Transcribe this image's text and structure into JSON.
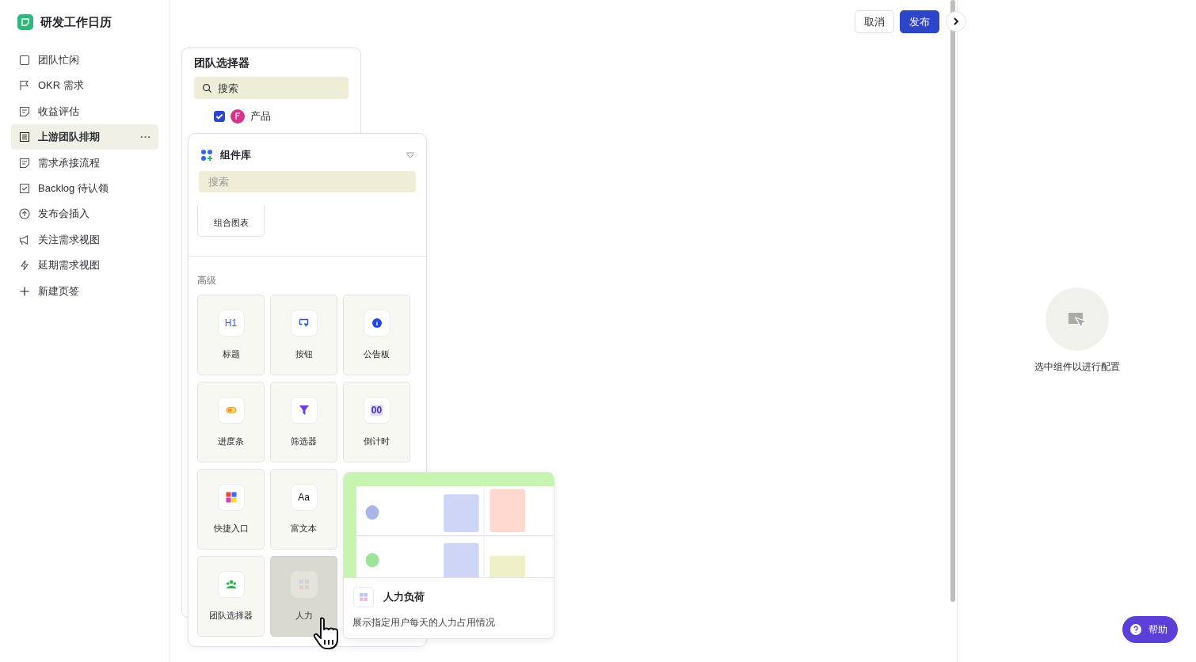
{
  "app": {
    "title": "研发工作日历"
  },
  "sidebar": {
    "items": [
      {
        "label": "团队忙闲",
        "selected": false
      },
      {
        "label": "OKR 需求",
        "selected": false
      },
      {
        "label": "收益评估",
        "selected": false
      },
      {
        "label": "上游团队排期",
        "selected": true
      },
      {
        "label": "需求承接流程",
        "selected": false
      },
      {
        "label": "Backlog 待认领",
        "selected": false
      },
      {
        "label": "发布会插入",
        "selected": false
      },
      {
        "label": "关注需求视图",
        "selected": false
      },
      {
        "label": "延期需求视图",
        "selected": false
      },
      {
        "label": "新建页签",
        "selected": false
      }
    ]
  },
  "toolbar": {
    "buttons": [
      {
        "label": "取消",
        "kind": "secondary"
      },
      {
        "label": "发布",
        "kind": "primary"
      }
    ]
  },
  "team_selector": {
    "title": "团队选择器",
    "search": {
      "placeholder": "搜索"
    },
    "teams": [
      {
        "label": "产品",
        "checked": true
      }
    ]
  },
  "component_library": {
    "title": "组件库",
    "search": {
      "placeholder": "搜索"
    },
    "basic_tiles": [
      {
        "label": "组合图表"
      }
    ],
    "sections": [
      {
        "title": "高级",
        "tiles": [
          {
            "label": "标题",
            "kind": "heading",
            "glyph": "H1",
            "selected": false
          },
          {
            "label": "按钮",
            "kind": "button",
            "selected": false
          },
          {
            "label": "公告板",
            "kind": "info",
            "selected": false
          },
          {
            "label": "进度条",
            "kind": "progress",
            "selected": false
          },
          {
            "label": "筛选器",
            "kind": "filter",
            "selected": false
          },
          {
            "label": "倒计时",
            "kind": "countdown",
            "glyph": "00",
            "selected": false
          },
          {
            "label": "快捷入口",
            "kind": "shortcut",
            "selected": false
          },
          {
            "label": "富文本",
            "kind": "richtext",
            "glyph": "Aa",
            "selected": false
          },
          {
            "label": "团队选择器",
            "kind": "team",
            "selected": false
          },
          {
            "label": "人力",
            "kind": "workload",
            "selected": true
          }
        ]
      }
    ]
  },
  "preview": {
    "title": "人力负荷",
    "description": "展示指定用户每天的人力占用情况"
  },
  "config_panel": {
    "empty_text": "选中组件以进行配置"
  },
  "help_button": {
    "label": "帮助"
  }
}
